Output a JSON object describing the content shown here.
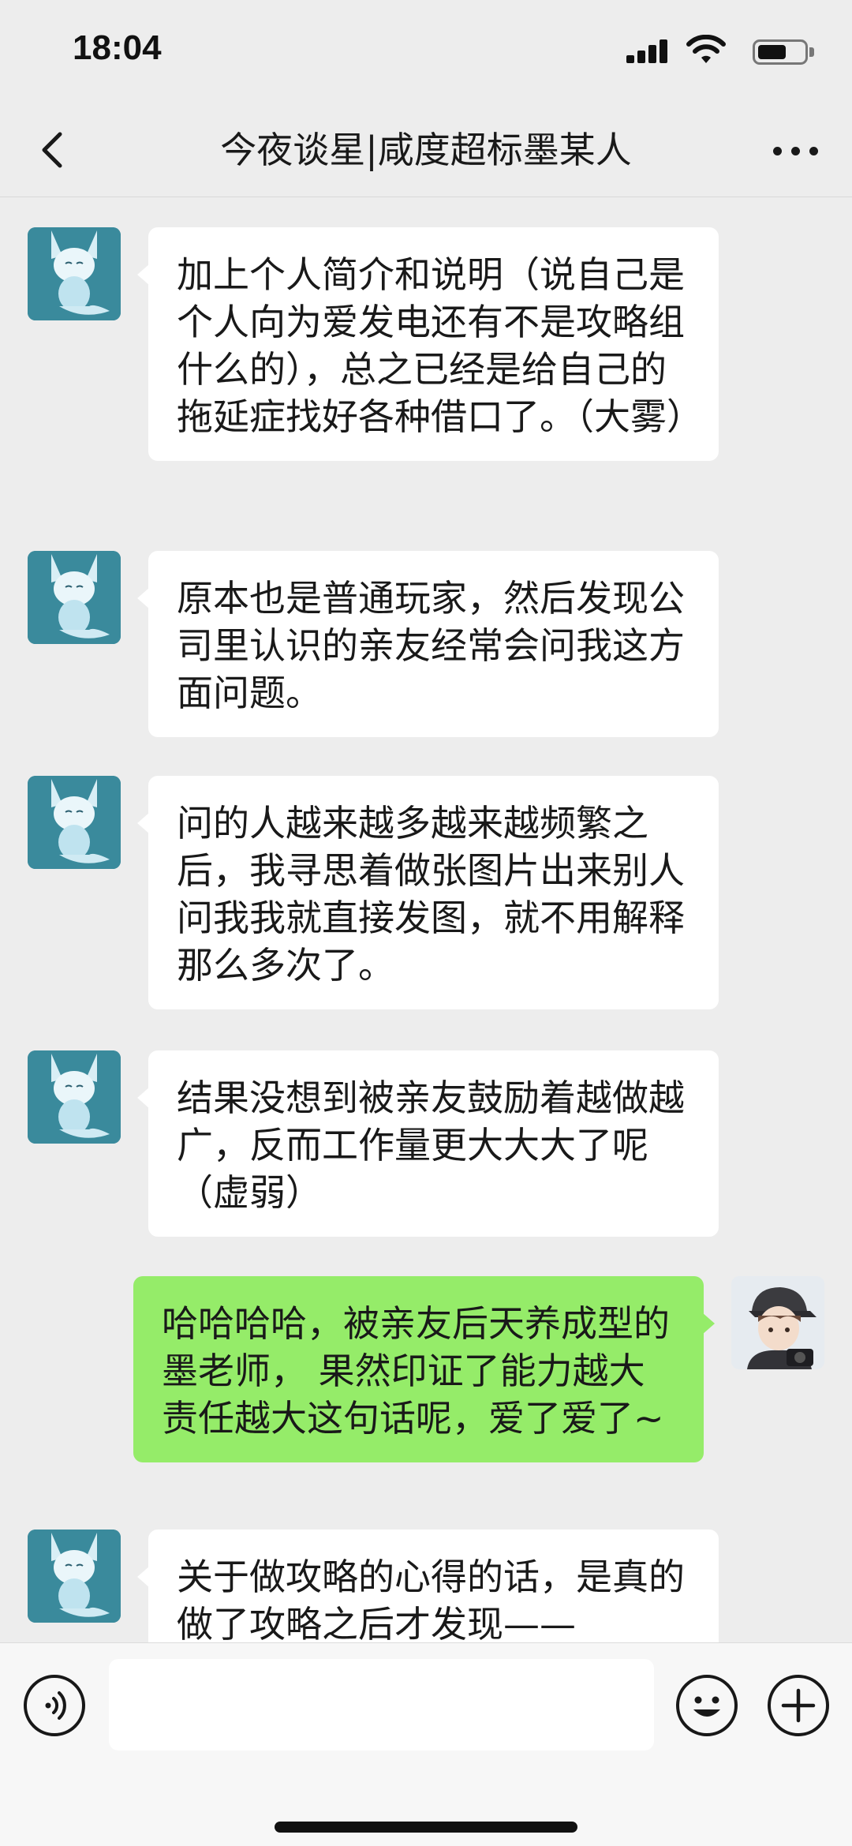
{
  "status_bar": {
    "time": "18:04",
    "battery_level": 0.6
  },
  "nav": {
    "title": "今夜谈星|咸度超标墨某人"
  },
  "messages": [
    {
      "side": "left",
      "text": "加上个人简介和说明（说自己是个人向为爱发电还有不是攻略组什么的），总之已经是给自己的拖延症找好各种借口了。（大雾）"
    },
    {
      "side": "left",
      "text": "原本也是普通玩家，然后发现公司里认识的亲友经常会问我这方面问题。"
    },
    {
      "side": "left",
      "text": "问的人越来越多越来越频繁之后，我寻思着做张图片出来别人问我我就直接发图，就不用解释那么多次了。"
    },
    {
      "side": "left",
      "text": "结果没想到被亲友鼓励着越做越广，反而工作量更大大大了呢（虚弱）"
    },
    {
      "side": "right",
      "text": "哈哈哈哈，被亲友后天养成型的墨老师， 果然印证了能力越大责任越大这句话呢，爱了爱了~"
    },
    {
      "side": "left",
      "text": "关于做攻略的心得的话，是真的做了攻略之后才发现——"
    }
  ],
  "input": {
    "value": "",
    "placeholder": ""
  },
  "colors": {
    "background": "#ededed",
    "bubble_self": "#95ec69",
    "bubble_other": "#ffffff"
  }
}
